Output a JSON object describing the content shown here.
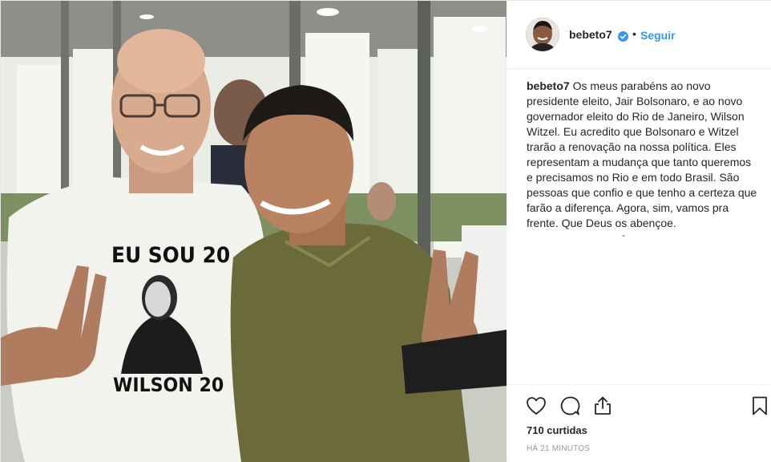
{
  "post": {
    "username": "bebeto7",
    "follow_label": "Seguir",
    "separator": "•",
    "caption": "Os meus parabéns ao novo presidente eleito, Jair Bolsonaro, e ao novo governador eleito do Rio de Janeiro, Wilson Witzel. Eu acredito que Bolsonaro e Witzel trarão a renovação na nossa política. Eles representam a mudança que tanto queremos e precisamos no Rio e em todo Brasil. São pessoas que confio e que tenho a certeza que farão a diferença. Agora, sim, vamos pra frente. Que Deus os abençoe.",
    "caption_more": "-",
    "likes": "710 curtidas",
    "timestamp": "HÁ 21 MINUTOS"
  },
  "photo": {
    "shirt_top_text": "EU SOU 20",
    "shirt_bottom_text": "WILSON 20"
  },
  "icons": {
    "like": "heart-icon",
    "comment": "comment-icon",
    "share": "share-icon",
    "save": "bookmark-icon",
    "verified": "verified-badge-icon"
  },
  "colors": {
    "link": "#3897f0",
    "text": "#262626",
    "muted": "#999999",
    "border": "#efefef"
  }
}
